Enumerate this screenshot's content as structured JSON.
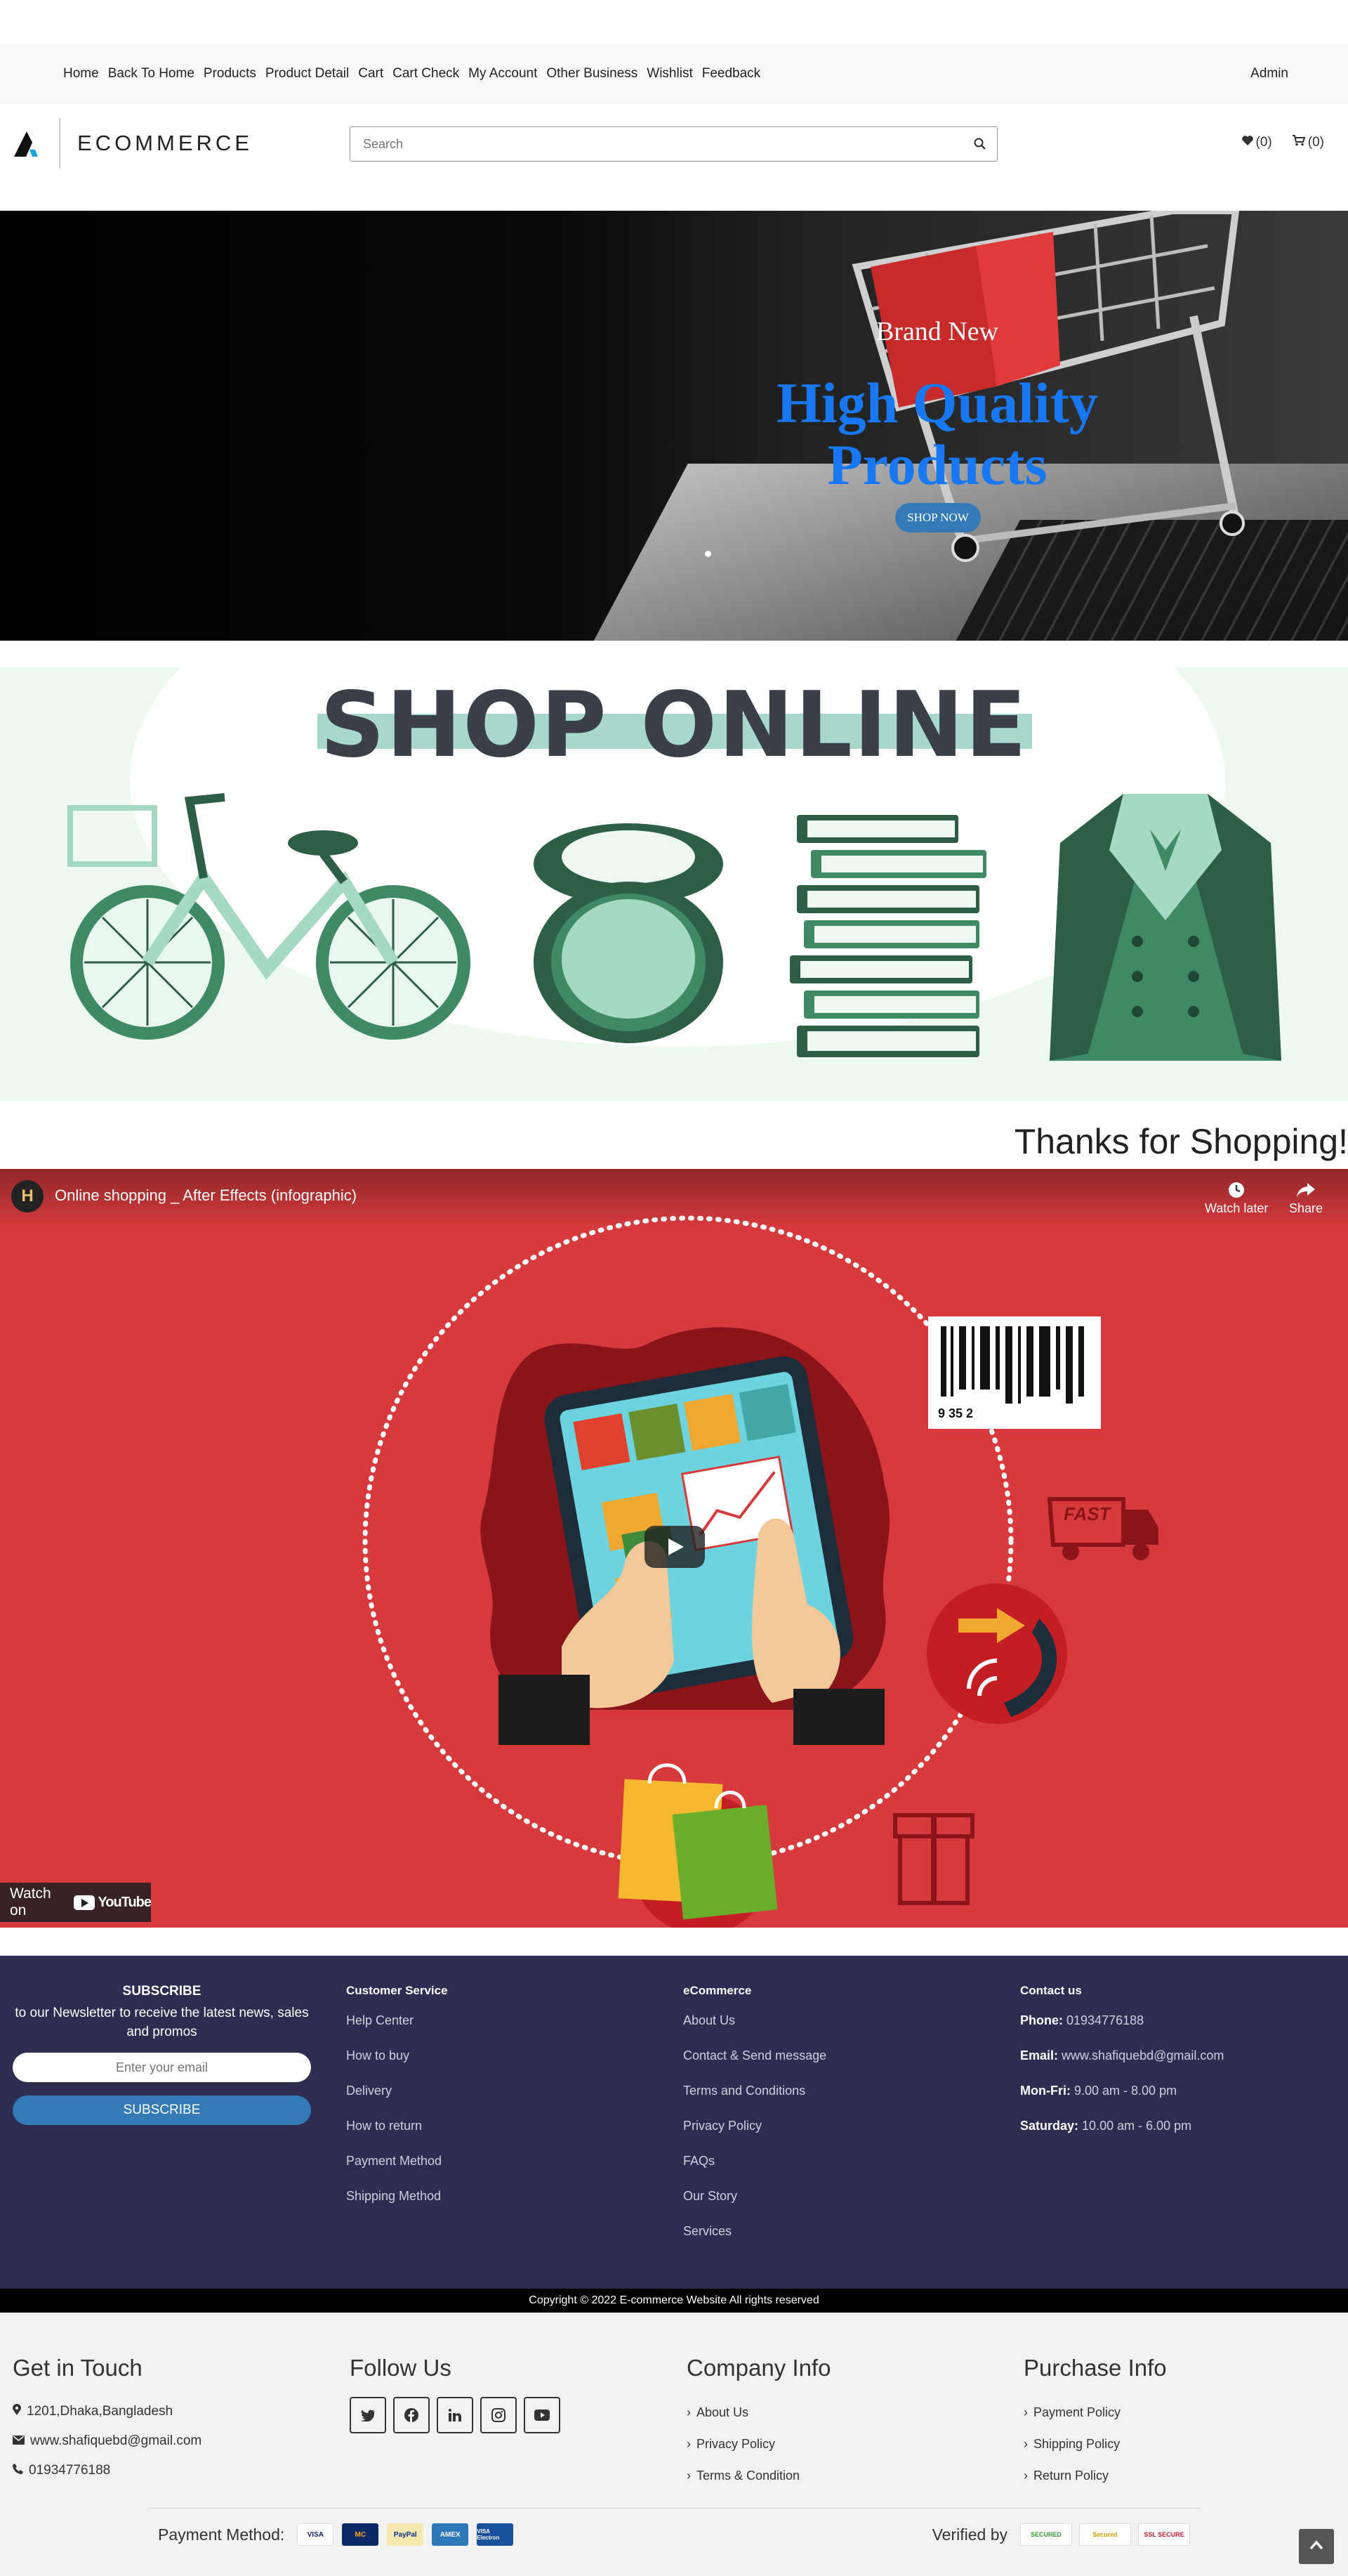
{
  "topnav": {
    "links": [
      "Home",
      "Back To Home",
      "Products",
      "Product Detail",
      "Cart",
      "Cart Check",
      "My Account",
      "Other Business",
      "Wishlist",
      "Feedback"
    ],
    "admin": "Admin"
  },
  "header": {
    "logo_text": "ECOMMERCE",
    "search_placeholder": "Search",
    "wishlist_count": "(0)",
    "cart_count": "(0)"
  },
  "hero": {
    "subtitle": "Brand New",
    "title": "High Quality Products",
    "button": "SHOP NOW"
  },
  "banner": {
    "title": "SHOP ONLINE"
  },
  "thanks": "Thanks for Shopping!",
  "video": {
    "channel_initial": "H",
    "title": "Online shopping _ After Effects (infographic)",
    "watch_later": "Watch later",
    "share": "Share",
    "watch_on": "Watch on",
    "youtube": "YouTube",
    "barcode_digits": "9 35 2",
    "truck_label": "FAST"
  },
  "footer": {
    "subscribe": {
      "heading": "SUBSCRIBE",
      "text": "to our Newsletter to receive the latest news, sales and promos",
      "placeholder": "Enter your email",
      "button": "SUBSCRIBE"
    },
    "customer_service": {
      "heading": "Customer Service",
      "items": [
        "Help Center",
        "How to buy",
        "Delivery",
        "How to return",
        "Payment Method",
        "Shipping Method"
      ]
    },
    "ecommerce": {
      "heading": "eCommerce",
      "items": [
        "About Us",
        "Contact & Send message",
        "Terms and Conditions",
        "Privacy Policy",
        "FAQs",
        "Our Story",
        "Services"
      ]
    },
    "contact": {
      "heading": "Contact us",
      "phone_label": "Phone:",
      "phone": "01934776188",
      "email_label": "Email:",
      "email": "www.shafiquebd@gmail.com",
      "monfri_label": "Mon-Fri:",
      "monfri": "9.00 am - 8.00 pm",
      "sat_label": "Saturday:",
      "sat": "10.00 am - 6.00 pm"
    },
    "copyright": "Copyright © 2022 E-commerce Website All rights reserved"
  },
  "lower": {
    "touch": {
      "heading": "Get in Touch",
      "address": "1201,Dhaka,Bangladesh",
      "email": "www.shafiquebd@gmail.com",
      "phone": "01934776188"
    },
    "follow": {
      "heading": "Follow Us"
    },
    "company": {
      "heading": "Company Info",
      "items": [
        "About Us",
        "Privacy Policy",
        "Terms & Condition"
      ]
    },
    "purchase": {
      "heading": "Purchase Info",
      "items": [
        "Payment Policy",
        "Shipping Policy",
        "Return Policy"
      ]
    },
    "payment_label": "Payment Method:",
    "cards": [
      "VISA",
      "MC",
      "PayPal",
      "AMEX",
      "VISA Electron"
    ],
    "verified_label": "Verified by",
    "badges": [
      "SECURED",
      "Secured",
      "SSL SECURE"
    ]
  },
  "colors": {
    "accent": "#337ab7",
    "hero_title": "#1877f2",
    "footer_bg": "#2f2c52",
    "video_bg": "#d63a3d"
  }
}
